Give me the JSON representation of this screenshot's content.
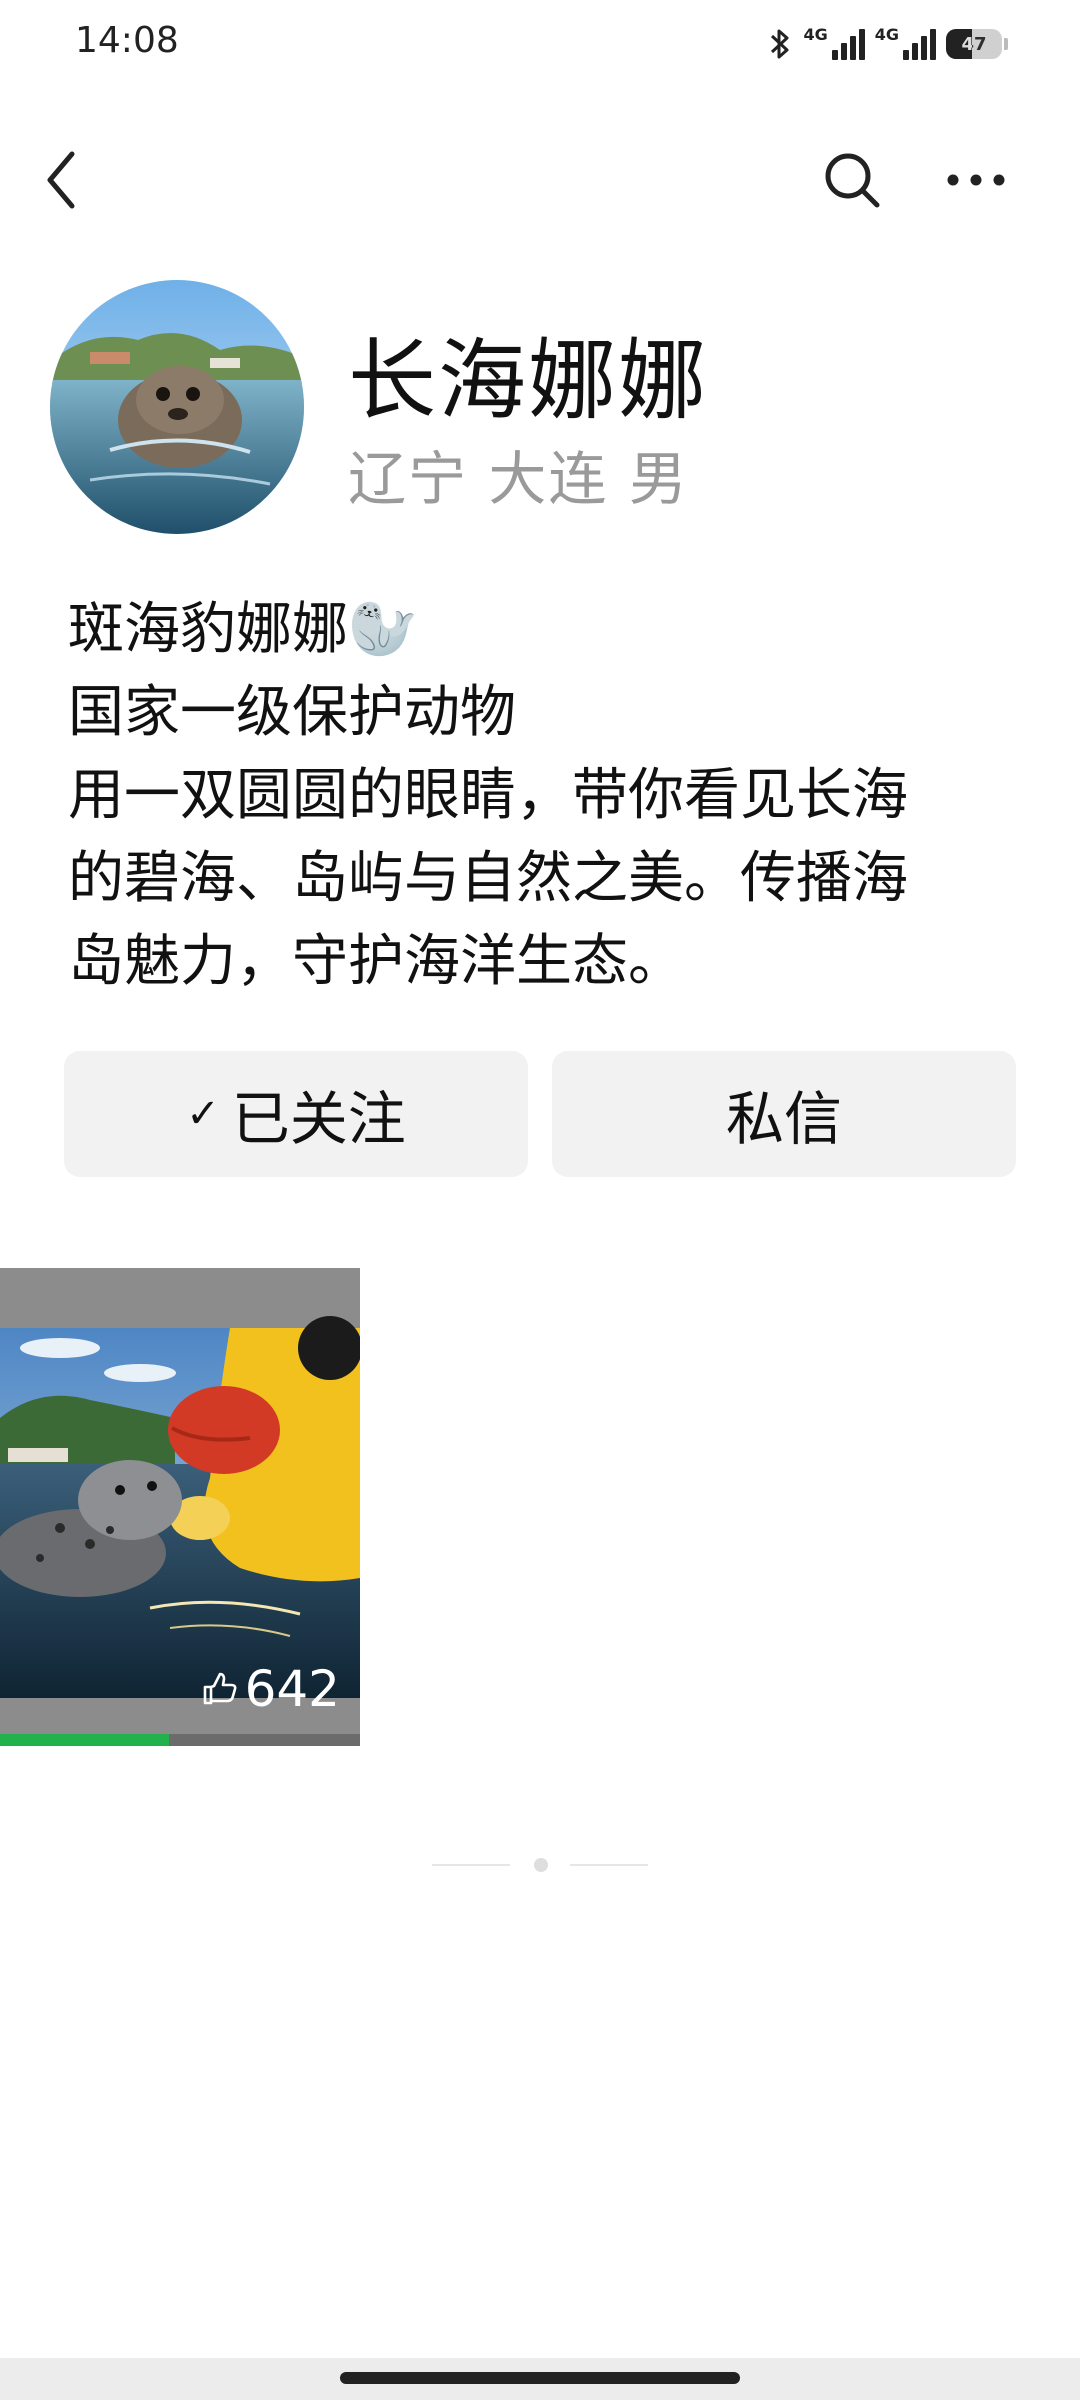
{
  "status_bar": {
    "time": "14:08",
    "network_1": "4G",
    "network_2": "4G",
    "battery": "47",
    "battery_level": 0.47
  },
  "nav": {
    "back_icon": "chevron-left-icon",
    "search_icon": "search-icon",
    "more_icon": "more-horizontal-icon"
  },
  "profile": {
    "name": "长海娜娜",
    "meta": "辽宁 大连 男",
    "bio_lines": [
      "斑海豹娜娜🦭",
      "国家一级保护动物",
      "用一双圆圆的眼睛，带你看见长海",
      "的碧海、岛屿与自然之美。传播海",
      "岛魅力，守护海洋生态。"
    ]
  },
  "actions": {
    "follow_label": "已关注",
    "follow_icon": "check-icon",
    "message_label": "私信"
  },
  "posts": [
    {
      "likes": "642",
      "like_icon": "thumbs-up-icon",
      "progress": 0.47
    }
  ],
  "colors": {
    "accent_green": "#23b14d",
    "button_bg": "#f2f2f2",
    "meta_gray": "#9a9a9a"
  }
}
